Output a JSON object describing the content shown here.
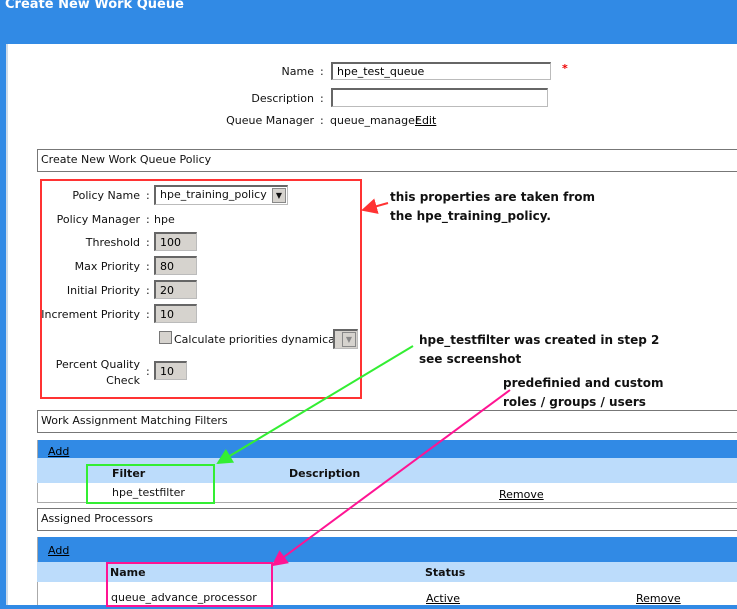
{
  "window": {
    "title": "Create New Work Queue"
  },
  "queue": {
    "name_label": "Name",
    "name_value": "hpe_test_queue",
    "required_mark": "*",
    "description_label": "Description",
    "description_value": "",
    "manager_label": "Queue Manager",
    "manager_value": "queue_manager",
    "edit_link": "Edit"
  },
  "policy": {
    "section_title": "Create New Work Queue Policy",
    "policy_name_label": "Policy Name",
    "policy_name_value": "hpe_training_policy",
    "policy_manager_label": "Policy Manager",
    "policy_manager_value": "hpe",
    "threshold_label": "Threshold",
    "threshold_value": "100",
    "max_priority_label": "Max Priority",
    "max_priority_value": "80",
    "initial_priority_label": "Initial Priority",
    "initial_priority_value": "20",
    "increment_priority_label": "Increment Priority",
    "increment_priority_value": "10",
    "calc_label": "Calculate priorities dynamically",
    "calc_checked": false,
    "pqc_label_1": "Percent Quality",
    "pqc_label_2": "Check",
    "pqc_value": "10"
  },
  "filters": {
    "section_title": "Work Assignment Matching Filters",
    "add_link": "Add",
    "columns": [
      "Filter",
      "Description"
    ],
    "rows": [
      {
        "filter": "hpe_testfilter",
        "description": "",
        "remove": "Remove"
      }
    ]
  },
  "processors": {
    "section_title": "Assigned Processors",
    "add_link": "Add",
    "columns": [
      "Name",
      "Status"
    ],
    "rows": [
      {
        "name": "queue_advance_processor",
        "status": "Active",
        "remove": "Remove"
      }
    ]
  },
  "annotations": {
    "policy_note": [
      "this properties are taken from",
      "the hpe_training_policy."
    ],
    "filter_note": [
      "hpe_testfilter was created in step 2",
      "see screenshot"
    ],
    "processor_note": [
      "predefinied and custom",
      "roles / groups / users"
    ]
  },
  "colors": {
    "header_blue": "#318ae5",
    "table_header": "#bcdcfb",
    "red_box": "#ff3333",
    "green_box": "#33ee33",
    "pink_box": "#ff1493"
  }
}
